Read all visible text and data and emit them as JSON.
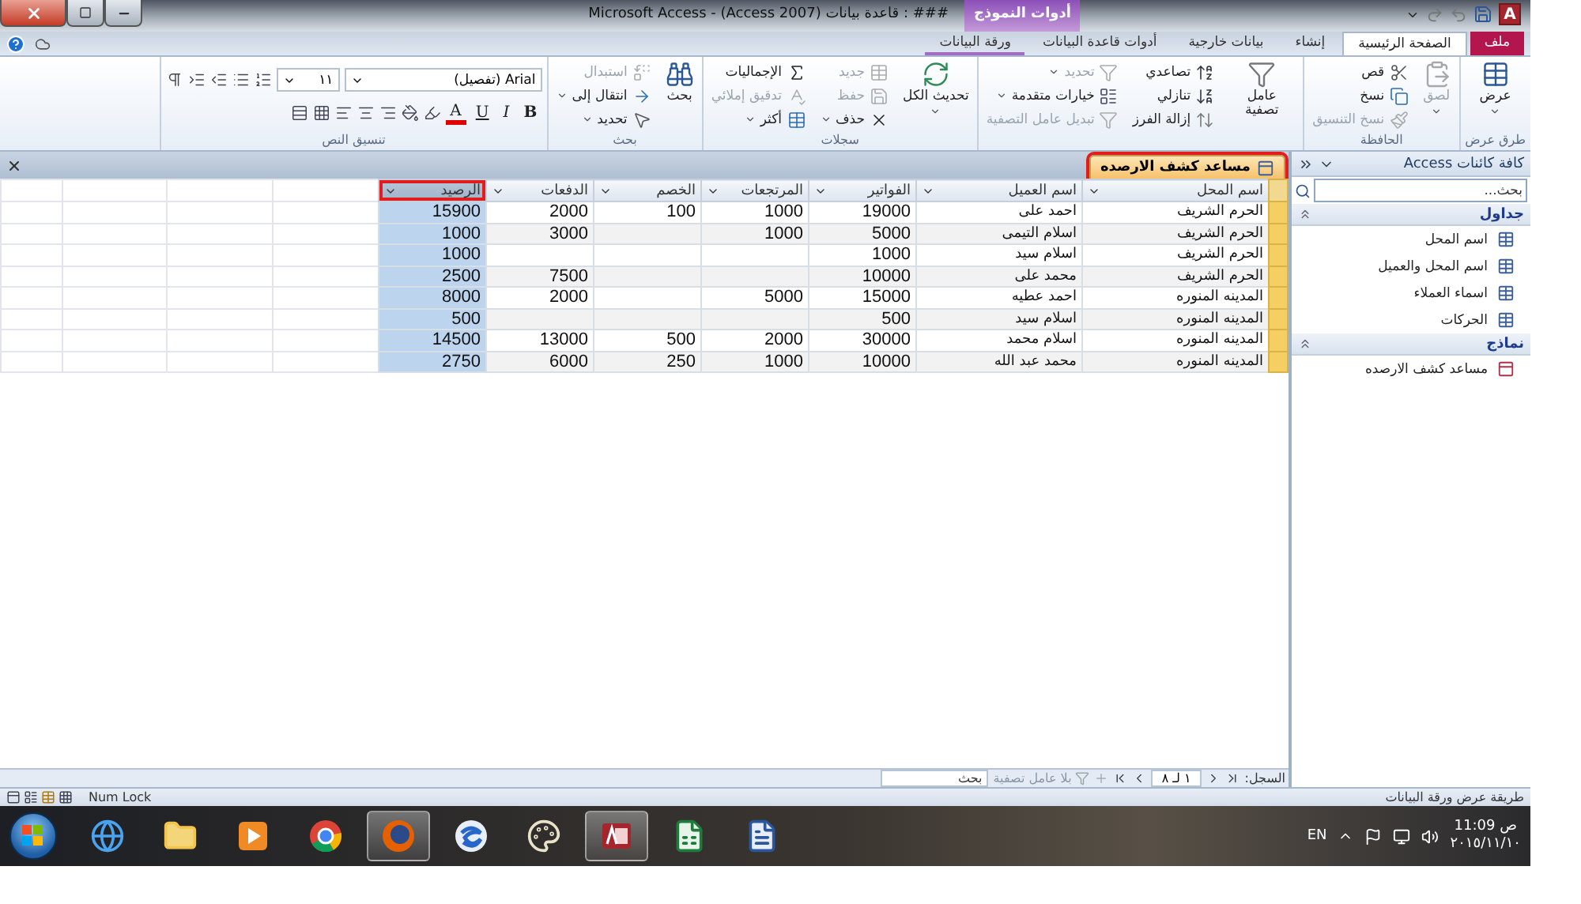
{
  "title_bar": {
    "title": "Microsoft Access - (Access 2007) قاعدة بيانات : ###",
    "logo": "A",
    "context_label": "أدوات النموذج"
  },
  "ribbon_tabs": [
    {
      "label": "ملف",
      "kind": "file",
      "selected": false
    },
    {
      "label": "الصفحة الرئيسية",
      "kind": "tab",
      "selected": true
    },
    {
      "label": "إنشاء",
      "kind": "tab",
      "selected": false
    },
    {
      "label": "بيانات خارجية",
      "kind": "tab",
      "selected": false
    },
    {
      "label": "أدوات قاعدة البيانات",
      "kind": "tab",
      "selected": false
    },
    {
      "label": "ورقة البيانات",
      "kind": "context",
      "selected": false
    }
  ],
  "ribbon_groups": [
    {
      "kind": "buttons",
      "label": "طرق عرض",
      "items": [
        {
          "label": "عرض",
          "dropdown": true,
          "disabled": false
        }
      ]
    },
    {
      "kind": "buttons",
      "label": "الحافظة",
      "items": [
        {
          "label": "لصق",
          "dropdown": true,
          "disabled": true
        },
        {
          "label": "قص",
          "dropdown": false,
          "disabled": false
        },
        {
          "label": "نسخ",
          "dropdown": false,
          "disabled": false
        },
        {
          "label": "نسخ التنسيق",
          "dropdown": false,
          "disabled": true
        }
      ]
    },
    {
      "kind": "buttons",
      "items": [
        {
          "label": "عامل تصفية",
          "dropdown": false,
          "disabled": false
        },
        {
          "label": "تصاعدي",
          "dropdown": false,
          "disabled": false
        },
        {
          "label": "تنازلي",
          "dropdown": false,
          "disabled": false
        },
        {
          "label": "إزالة الفرز",
          "dropdown": false,
          "disabled": false
        },
        {
          "label": "تحديد",
          "dropdown": true,
          "disabled": true
        },
        {
          "label": "خيارات متقدمة",
          "dropdown": true,
          "disabled": false
        },
        {
          "label": "تبديل عامل التصفية",
          "dropdown": false,
          "disabled": true
        }
      ]
    },
    {
      "kind": "buttons",
      "label": "سجلات",
      "items": [
        {
          "label": "تحديث الكل",
          "dropdown": true,
          "disabled": false
        },
        {
          "label": "جديد",
          "dropdown": false,
          "disabled": true
        },
        {
          "label": "حفظ",
          "dropdown": false,
          "disabled": true
        },
        {
          "label": "حذف",
          "dropdown": true,
          "disabled": false
        },
        {
          "label": "الإجماليات",
          "dropdown": false,
          "disabled": false
        },
        {
          "label": "تدقيق إملائي",
          "dropdown": false,
          "disabled": true
        },
        {
          "label": "أكثر",
          "dropdown": true,
          "disabled": false
        }
      ]
    },
    {
      "kind": "buttons",
      "label": "بحث",
      "items": [
        {
          "label": "بحث",
          "dropdown": false,
          "disabled": false
        },
        {
          "label": "استبدال",
          "dropdown": false,
          "disabled": true
        },
        {
          "label": "انتقال إلى",
          "dropdown": true,
          "disabled": false
        },
        {
          "label": "تحديد",
          "dropdown": true,
          "disabled": false
        }
      ]
    },
    {
      "kind": "text_format",
      "label": "تنسيق النص",
      "font": "Arial (تفصيل)",
      "size": "١١",
      "styles": [
        {
          "label": "B",
          "kind": "bold"
        },
        {
          "label": "I",
          "kind": "italic"
        },
        {
          "label": "U",
          "kind": "underline"
        },
        {
          "label": "A",
          "kind": "font_color"
        }
      ]
    }
  ],
  "document": {
    "tab": {
      "label": "مساعد كشف الارصده",
      "selected": true,
      "circled": true
    },
    "columns": [
      {
        "label": "اسم المحل",
        "selected": false,
        "circled": false
      },
      {
        "label": "اسم العميل",
        "selected": false,
        "circled": false
      },
      {
        "label": "الفواتير",
        "selected": false,
        "circled": false
      },
      {
        "label": "المرتجعات",
        "selected": false,
        "circled": false
      },
      {
        "label": "الخصم",
        "selected": false,
        "circled": false
      },
      {
        "label": "الدفعات",
        "selected": false,
        "circled": false
      },
      {
        "label": "الرصيد",
        "selected": true,
        "circled": true
      }
    ],
    "rows": [
      [
        "الحرم الشريف",
        "احمد على",
        "19000",
        "1000",
        "100",
        "2000",
        "15900"
      ],
      [
        "الحرم الشريف",
        "اسلام التيمى",
        "5000",
        "1000",
        null,
        "3000",
        "1000"
      ],
      [
        "الحرم الشريف",
        "اسلام سيد",
        "1000",
        null,
        null,
        null,
        "1000"
      ],
      [
        "الحرم الشريف",
        "محمد على",
        "10000",
        null,
        null,
        "7500",
        "2500"
      ],
      [
        "المدينه المنوره",
        "احمد عطيه",
        "15000",
        "5000",
        null,
        "2000",
        "8000"
      ],
      [
        "المدينه المنوره",
        "اسلام سيد",
        "500",
        null,
        null,
        null,
        "500"
      ],
      [
        "المدينه المنوره",
        "اسلام محمد",
        "30000",
        "2000",
        "500",
        "13000",
        "14500"
      ],
      [
        "المدينه المنوره",
        "محمد عبد الله",
        "10000",
        "1000",
        "250",
        "6000",
        "2750"
      ]
    ],
    "record_nav": {
      "label": "السجل:",
      "position": "١ لـ ٨",
      "filter": "بلا عامل تصفية",
      "search_placeholder": "بحث"
    }
  },
  "nav_pane": {
    "title": "كافة كائنات Access",
    "search_placeholder": "بحث...",
    "groups": [
      {
        "label": "جداول",
        "expanded": true,
        "items": [
          {
            "label": "اسم المحل",
            "kind": "table"
          },
          {
            "label": "اسم المحل والعميل",
            "kind": "table"
          },
          {
            "label": "اسماء العملاء",
            "kind": "table"
          },
          {
            "label": "الحركات",
            "kind": "table"
          }
        ]
      },
      {
        "label": "نماذج",
        "expanded": true,
        "items": [
          {
            "label": "مساعد كشف الارصده",
            "kind": "form"
          }
        ]
      }
    ]
  },
  "status_bar": {
    "view": "طريقة عرض ورقة البيانات",
    "indicator": "Num Lock"
  },
  "taskbar": {
    "apps": [
      {
        "kind": "ie",
        "open": false
      },
      {
        "kind": "folder",
        "open": false
      },
      {
        "kind": "media",
        "open": false
      },
      {
        "kind": "chrome",
        "open": false
      },
      {
        "kind": "firefox",
        "open": true
      },
      {
        "kind": "swirl",
        "open": false
      },
      {
        "kind": "paint",
        "open": false
      },
      {
        "kind": "access",
        "open": true
      },
      {
        "kind": "excel",
        "open": false
      },
      {
        "kind": "word",
        "open": false
      }
    ],
    "language": "EN",
    "time": "ص 11:09",
    "date": "٢٠١٥/١١/١٠"
  }
}
